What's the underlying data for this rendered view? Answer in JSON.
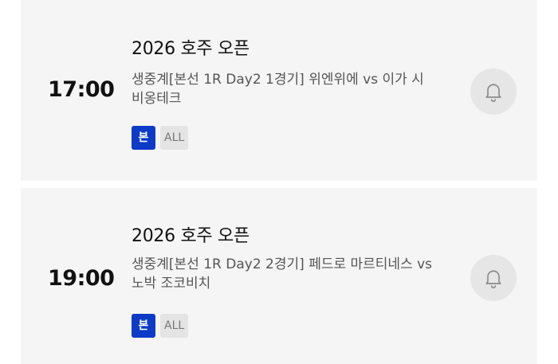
{
  "schedule": [
    {
      "time": "17:00",
      "title": "2026 호주 오픈",
      "description": "생중계[본선 1R Day2 1경기] 위엔위에 vs 이가 시비옹테크",
      "badges": [
        "본",
        "ALL"
      ]
    },
    {
      "time": "19:00",
      "title": "2026 호주 오픈",
      "description": "생중계[본선 1R Day2 2경기] 페드로 마르티네스 vs 노박 조코비치",
      "badges": [
        "본",
        "ALL"
      ]
    }
  ],
  "icons": {
    "alert": "bell-icon"
  },
  "colors": {
    "card_bg": "#f5f5f5",
    "badge_primary": "#0b3bc7",
    "badge_secondary": "#e4e4e4"
  }
}
